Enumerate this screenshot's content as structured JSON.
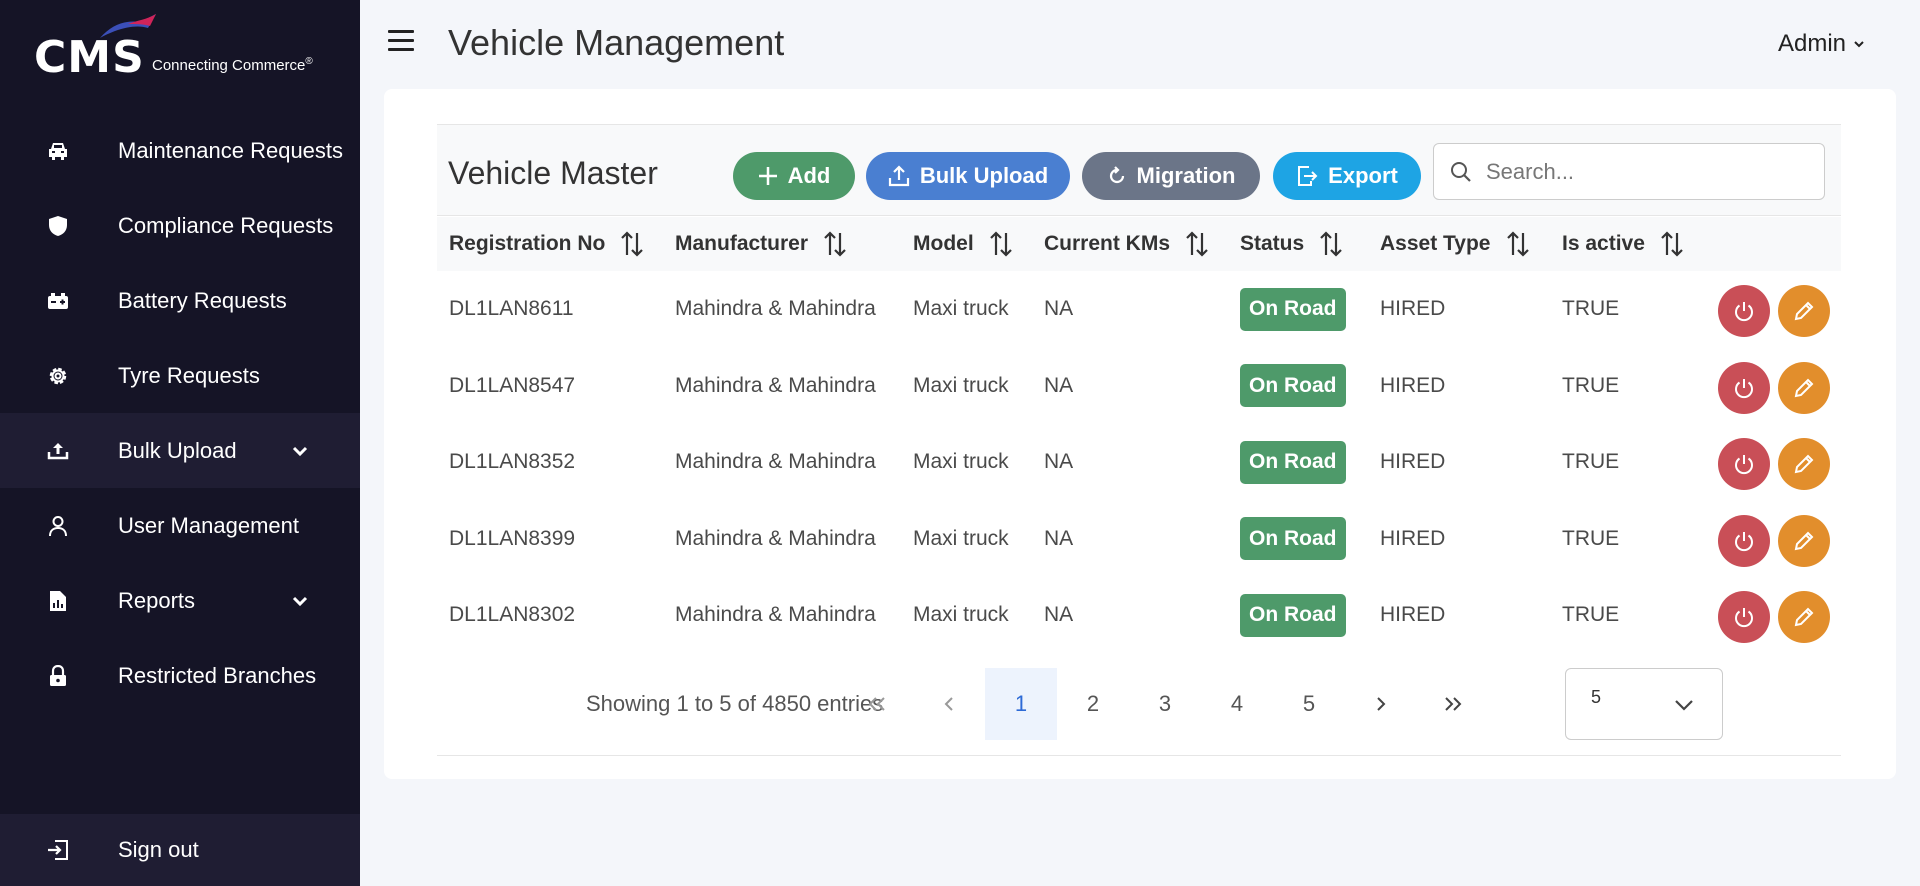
{
  "sidebar": {
    "logo_text": "CMS",
    "logo_tagline": "Connecting Commerce",
    "logo_reg": "®",
    "items": [
      {
        "label": "Maintenance Requests",
        "icon": "car-icon"
      },
      {
        "label": "Compliance Requests",
        "icon": "shield-icon"
      },
      {
        "label": "Battery Requests",
        "icon": "battery-icon"
      },
      {
        "label": "Tyre Requests",
        "icon": "gear-icon"
      },
      {
        "label": "Bulk Upload",
        "icon": "upload-icon"
      },
      {
        "label": "User Management",
        "icon": "user-icon"
      },
      {
        "label": "Reports",
        "icon": "report-icon"
      },
      {
        "label": "Restricted Branches",
        "icon": "lock-icon"
      }
    ],
    "signout_label": "Sign out"
  },
  "header": {
    "title": "Vehicle Management",
    "user_menu": "Admin"
  },
  "panel": {
    "title": "Vehicle Master",
    "add_label": "Add",
    "bulk_upload_label": "Bulk Upload",
    "migration_label": "Migration",
    "export_label": "Export",
    "search_placeholder": "Search..."
  },
  "table": {
    "columns": [
      "Registration No",
      "Manufacturer",
      "Model",
      "Current KMs",
      "Status",
      "Asset Type",
      "Is active"
    ],
    "rows": [
      {
        "reg": "DL1LAN8611",
        "manufacturer": "Mahindra & Mahindra",
        "model": "Maxi truck",
        "kms": "NA",
        "status": "On Road",
        "asset": "HIRED",
        "active": "TRUE"
      },
      {
        "reg": "DL1LAN8547",
        "manufacturer": "Mahindra & Mahindra",
        "model": "Maxi truck",
        "kms": "NA",
        "status": "On Road",
        "asset": "HIRED",
        "active": "TRUE"
      },
      {
        "reg": "DL1LAN8352",
        "manufacturer": "Mahindra & Mahindra",
        "model": "Maxi truck",
        "kms": "NA",
        "status": "On Road",
        "asset": "HIRED",
        "active": "TRUE"
      },
      {
        "reg": "DL1LAN8399",
        "manufacturer": "Mahindra & Mahindra",
        "model": "Maxi truck",
        "kms": "NA",
        "status": "On Road",
        "asset": "HIRED",
        "active": "TRUE"
      },
      {
        "reg": "DL1LAN8302",
        "manufacturer": "Mahindra & Mahindra",
        "model": "Maxi truck",
        "kms": "NA",
        "status": "On Road",
        "asset": "HIRED",
        "active": "TRUE"
      }
    ]
  },
  "pagination": {
    "info": "Showing 1 to 5 of 4850 entries",
    "pages": [
      "1",
      "2",
      "3",
      "4",
      "5"
    ],
    "current_page": "1",
    "rows_per_page": "5"
  },
  "colors": {
    "sidebar_bg": "#151426",
    "success": "#4e9a6a",
    "primary": "#4a7fd1",
    "secondary": "#6b7588",
    "info": "#1ea4e4",
    "danger": "#c94f57",
    "warning": "#e28e2c"
  }
}
